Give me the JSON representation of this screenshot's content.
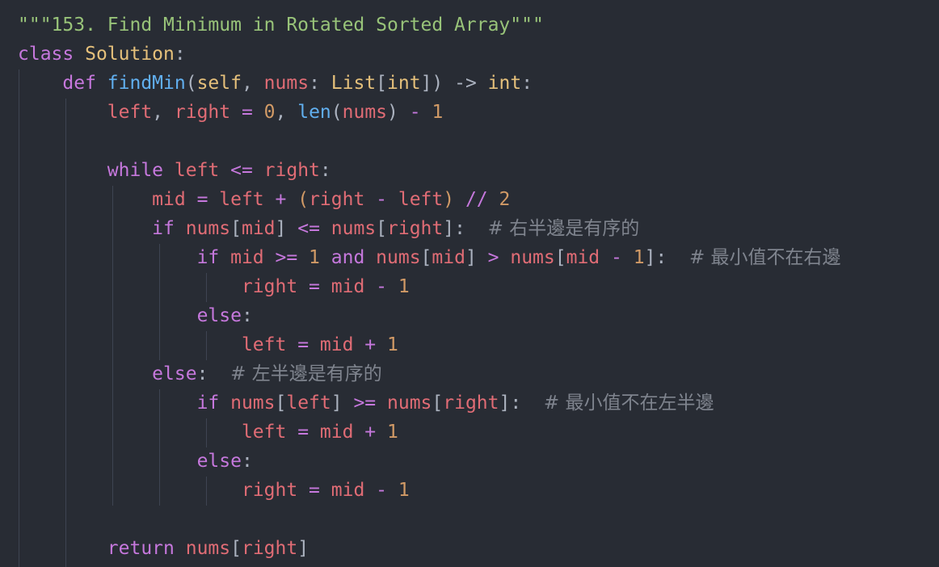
{
  "editor": {
    "theme_colors": {
      "background": "#282c34",
      "string": "#98c379",
      "keyword": "#c678dd",
      "class": "#e5c07b",
      "function": "#61afef",
      "variable": "#e06c75",
      "number": "#d19a66",
      "comment": "#7f848e"
    },
    "lines": [
      [
        {
          "c": "str",
          "t": "\"\"\"153. Find Minimum in Rotated Sorted Array\"\"\""
        }
      ],
      [
        {
          "c": "kw",
          "t": "class "
        },
        {
          "c": "cls",
          "t": "Solution"
        },
        {
          "c": "pun",
          "t": ":"
        }
      ],
      [
        {
          "c": "plain",
          "t": "    "
        },
        {
          "c": "kw",
          "t": "def "
        },
        {
          "c": "fn",
          "t": "findMin"
        },
        {
          "c": "pun",
          "t": "("
        },
        {
          "c": "self",
          "t": "self"
        },
        {
          "c": "pun",
          "t": ", "
        },
        {
          "c": "var",
          "t": "nums"
        },
        {
          "c": "pun",
          "t": ": "
        },
        {
          "c": "cls",
          "t": "List"
        },
        {
          "c": "pun",
          "t": "["
        },
        {
          "c": "cls",
          "t": "int"
        },
        {
          "c": "pun",
          "t": "]) "
        },
        {
          "c": "pun",
          "t": "-> "
        },
        {
          "c": "cls",
          "t": "int"
        },
        {
          "c": "pun",
          "t": ":"
        }
      ],
      [
        {
          "c": "plain",
          "t": "        "
        },
        {
          "c": "var",
          "t": "left"
        },
        {
          "c": "pun",
          "t": ", "
        },
        {
          "c": "var",
          "t": "right"
        },
        {
          "c": "op",
          "t": " = "
        },
        {
          "c": "num",
          "t": "0"
        },
        {
          "c": "pun",
          "t": ", "
        },
        {
          "c": "fn",
          "t": "len"
        },
        {
          "c": "pun",
          "t": "("
        },
        {
          "c": "var",
          "t": "nums"
        },
        {
          "c": "pun",
          "t": ")"
        },
        {
          "c": "op",
          "t": " - "
        },
        {
          "c": "num",
          "t": "1"
        }
      ],
      [],
      [
        {
          "c": "plain",
          "t": "        "
        },
        {
          "c": "kw",
          "t": "while "
        },
        {
          "c": "var",
          "t": "left"
        },
        {
          "c": "op",
          "t": " <= "
        },
        {
          "c": "var",
          "t": "right"
        },
        {
          "c": "pun",
          "t": ":"
        }
      ],
      [
        {
          "c": "plain",
          "t": "            "
        },
        {
          "c": "var",
          "t": "mid"
        },
        {
          "c": "op",
          "t": " = "
        },
        {
          "c": "var",
          "t": "left"
        },
        {
          "c": "op",
          "t": " + "
        },
        {
          "c": "num",
          "t": "("
        },
        {
          "c": "var",
          "t": "right"
        },
        {
          "c": "op",
          "t": " - "
        },
        {
          "c": "var",
          "t": "left"
        },
        {
          "c": "num",
          "t": ")"
        },
        {
          "c": "op",
          "t": " // "
        },
        {
          "c": "num",
          "t": "2"
        }
      ],
      [
        {
          "c": "plain",
          "t": "            "
        },
        {
          "c": "kw",
          "t": "if "
        },
        {
          "c": "var",
          "t": "nums"
        },
        {
          "c": "pun",
          "t": "["
        },
        {
          "c": "var",
          "t": "mid"
        },
        {
          "c": "pun",
          "t": "]"
        },
        {
          "c": "op",
          "t": " <= "
        },
        {
          "c": "var",
          "t": "nums"
        },
        {
          "c": "pun",
          "t": "["
        },
        {
          "c": "var",
          "t": "right"
        },
        {
          "c": "pun",
          "t": "]:"
        },
        {
          "c": "plain",
          "t": "  "
        },
        {
          "c": "cmt",
          "t": "# 右半邊是有序的"
        }
      ],
      [
        {
          "c": "plain",
          "t": "                "
        },
        {
          "c": "kw",
          "t": "if "
        },
        {
          "c": "var",
          "t": "mid"
        },
        {
          "c": "op",
          "t": " >= "
        },
        {
          "c": "num",
          "t": "1"
        },
        {
          "c": "kw",
          "t": " and "
        },
        {
          "c": "var",
          "t": "nums"
        },
        {
          "c": "pun",
          "t": "["
        },
        {
          "c": "var",
          "t": "mid"
        },
        {
          "c": "pun",
          "t": "]"
        },
        {
          "c": "op",
          "t": " > "
        },
        {
          "c": "var",
          "t": "nums"
        },
        {
          "c": "pun",
          "t": "["
        },
        {
          "c": "var",
          "t": "mid"
        },
        {
          "c": "op",
          "t": " - "
        },
        {
          "c": "num",
          "t": "1"
        },
        {
          "c": "pun",
          "t": "]:"
        },
        {
          "c": "plain",
          "t": "  "
        },
        {
          "c": "cmt",
          "t": "# 最小值不在右邊"
        }
      ],
      [
        {
          "c": "plain",
          "t": "                    "
        },
        {
          "c": "var",
          "t": "right"
        },
        {
          "c": "op",
          "t": " = "
        },
        {
          "c": "var",
          "t": "mid"
        },
        {
          "c": "op",
          "t": " - "
        },
        {
          "c": "num",
          "t": "1"
        }
      ],
      [
        {
          "c": "plain",
          "t": "                "
        },
        {
          "c": "kw",
          "t": "else"
        },
        {
          "c": "pun",
          "t": ":"
        }
      ],
      [
        {
          "c": "plain",
          "t": "                    "
        },
        {
          "c": "var",
          "t": "left"
        },
        {
          "c": "op",
          "t": " = "
        },
        {
          "c": "var",
          "t": "mid"
        },
        {
          "c": "op",
          "t": " + "
        },
        {
          "c": "num",
          "t": "1"
        }
      ],
      [
        {
          "c": "plain",
          "t": "            "
        },
        {
          "c": "kw",
          "t": "else"
        },
        {
          "c": "pun",
          "t": ":"
        },
        {
          "c": "plain",
          "t": "  "
        },
        {
          "c": "cmt",
          "t": "# 左半邊是有序的"
        }
      ],
      [
        {
          "c": "plain",
          "t": "                "
        },
        {
          "c": "kw",
          "t": "if "
        },
        {
          "c": "var",
          "t": "nums"
        },
        {
          "c": "pun",
          "t": "["
        },
        {
          "c": "var",
          "t": "left"
        },
        {
          "c": "pun",
          "t": "]"
        },
        {
          "c": "op",
          "t": " >= "
        },
        {
          "c": "var",
          "t": "nums"
        },
        {
          "c": "pun",
          "t": "["
        },
        {
          "c": "var",
          "t": "right"
        },
        {
          "c": "pun",
          "t": "]:"
        },
        {
          "c": "plain",
          "t": "  "
        },
        {
          "c": "cmt",
          "t": "# 最小值不在左半邊"
        }
      ],
      [
        {
          "c": "plain",
          "t": "                    "
        },
        {
          "c": "var",
          "t": "left"
        },
        {
          "c": "op",
          "t": " = "
        },
        {
          "c": "var",
          "t": "mid"
        },
        {
          "c": "op",
          "t": " + "
        },
        {
          "c": "num",
          "t": "1"
        }
      ],
      [
        {
          "c": "plain",
          "t": "                "
        },
        {
          "c": "kw",
          "t": "else"
        },
        {
          "c": "pun",
          "t": ":"
        }
      ],
      [
        {
          "c": "plain",
          "t": "                    "
        },
        {
          "c": "var",
          "t": "right"
        },
        {
          "c": "op",
          "t": " = "
        },
        {
          "c": "var",
          "t": "mid"
        },
        {
          "c": "op",
          "t": " - "
        },
        {
          "c": "num",
          "t": "1"
        }
      ],
      [],
      [
        {
          "c": "plain",
          "t": "        "
        },
        {
          "c": "kw",
          "t": "return "
        },
        {
          "c": "var",
          "t": "nums"
        },
        {
          "c": "pun",
          "t": "["
        },
        {
          "c": "var",
          "t": "right"
        },
        {
          "c": "pun",
          "t": "]"
        }
      ]
    ]
  }
}
